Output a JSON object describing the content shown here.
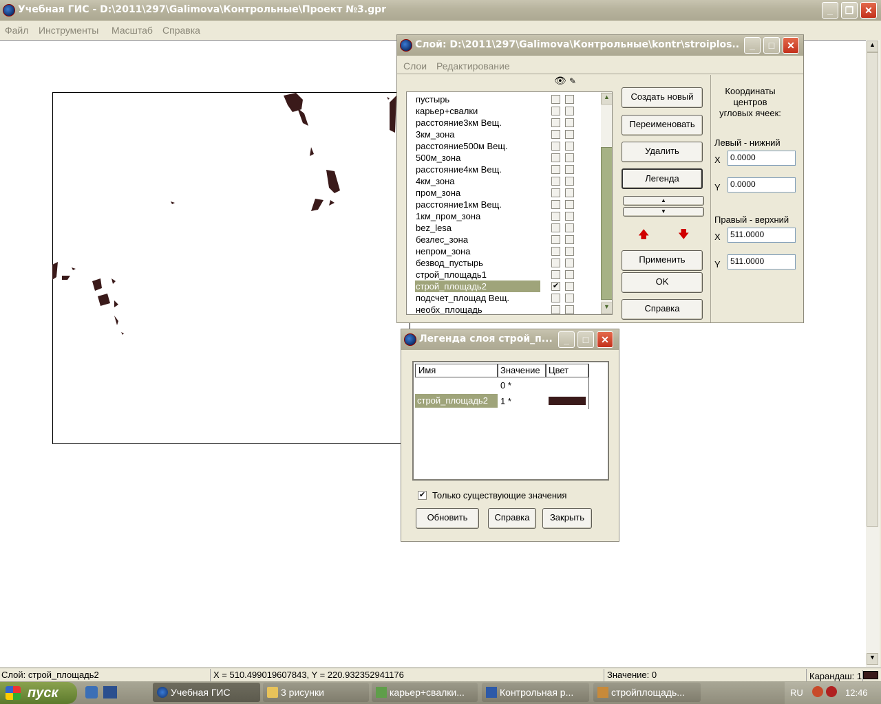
{
  "main_window": {
    "title": "Учебная ГИС - D:\\2011\\297\\Galimova\\Контрольные\\Проект №3.gpr",
    "menu": [
      "Файл",
      "Инструменты",
      "Масштаб",
      "Справка"
    ]
  },
  "layer_dialog": {
    "title": "Слой: D:\\2011\\297\\Galimova\\Контрольные\\kontr\\stroiplos...",
    "menu": [
      "Слои",
      "Редактирование"
    ],
    "layers": [
      {
        "name": "пустырь",
        "visible": false,
        "selected": false
      },
      {
        "name": "карьер+свалки",
        "visible": false,
        "selected": false
      },
      {
        "name": "расстояние3км Вещ.",
        "visible": false,
        "selected": false
      },
      {
        "name": "3км_зона",
        "visible": false,
        "selected": false
      },
      {
        "name": "расстояние500м Вещ.",
        "visible": false,
        "selected": false
      },
      {
        "name": "500м_зона",
        "visible": false,
        "selected": false
      },
      {
        "name": "расстояние4км Вещ.",
        "visible": false,
        "selected": false
      },
      {
        "name": "4км_зона",
        "visible": false,
        "selected": false
      },
      {
        "name": "пром_зона",
        "visible": false,
        "selected": false
      },
      {
        "name": "расстояние1км Вещ.",
        "visible": false,
        "selected": false
      },
      {
        "name": "1км_пром_зона",
        "visible": false,
        "selected": false
      },
      {
        "name": "bez_lesa",
        "visible": false,
        "selected": false
      },
      {
        "name": "безлес_зона",
        "visible": false,
        "selected": false
      },
      {
        "name": "непром_зона",
        "visible": false,
        "selected": false
      },
      {
        "name": "безвод_пустырь",
        "visible": false,
        "selected": false
      },
      {
        "name": "строй_площадь1",
        "visible": false,
        "selected": false
      },
      {
        "name": "строй_площадь2",
        "visible": true,
        "selected": true
      },
      {
        "name": "подсчет_площад Вещ.",
        "visible": false,
        "selected": false
      },
      {
        "name": "необх_площадь",
        "visible": false,
        "selected": false
      }
    ],
    "buttons": {
      "create": "Создать новый",
      "rename": "Переименовать",
      "delete": "Удалить",
      "legend": "Легенда",
      "apply": "Применить",
      "ok": "OK",
      "help": "Справка"
    },
    "coords": {
      "heading": "Координаты центров угловых ячеек:",
      "lower_left_label": "Левый - нижний",
      "upper_right_label": "Правый - верхний",
      "x_label": "X",
      "y_label": "Y",
      "ll_x": "0.0000",
      "ll_y": "0.0000",
      "ur_x": "511.0000",
      "ur_y": "511.0000"
    }
  },
  "legend_dialog": {
    "title": "Легенда слоя строй_п...",
    "columns": [
      "Имя",
      "Значение",
      "Цвет"
    ],
    "rows": [
      {
        "name": "",
        "value": "0 *",
        "color": ""
      },
      {
        "name": "строй_площадь2",
        "value": "1 *",
        "color": "#3A1A1A"
      }
    ],
    "only_existing_label": "Только существующие значения",
    "only_existing_checked": true,
    "buttons": {
      "refresh": "Обновить",
      "help": "Справка",
      "close": "Закрыть"
    }
  },
  "status_bar": {
    "layer": "Слой: строй_площадь2",
    "coords": "X = 510.499019607843, Y = 220.932352941176",
    "value": "Значение: 0",
    "pencil": "Карандаш: 1"
  },
  "taskbar": {
    "start": "пуск",
    "items": [
      "Учебная ГИС",
      "3 рисунки",
      "карьер+свалки...",
      "Контрольная р...",
      "стройплощадь..."
    ],
    "lang": "RU",
    "clock": "12:46"
  },
  "colors": {
    "feature": "#3A1A1A",
    "selection": "#9FA47A"
  }
}
